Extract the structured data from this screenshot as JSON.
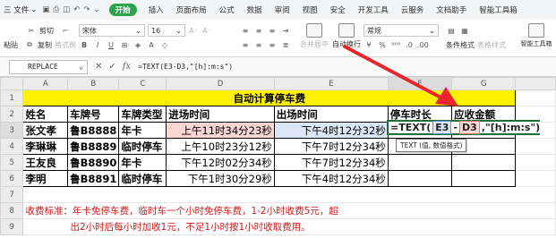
{
  "menubar": {
    "file_label": "三 文件",
    "start_label": "开始",
    "tabs": [
      "插入",
      "页面布局",
      "公式",
      "数据",
      "审阅",
      "视图",
      "安全",
      "开发工具",
      "云服务",
      "文档助手",
      "智能工具箱"
    ]
  },
  "toolbar": {
    "cut": "剪切",
    "paste": "粘贴",
    "copy": "复制",
    "format_painter": "格式刷",
    "font_name": "宋体",
    "font_size": "16",
    "merge_center": "合并居中",
    "wrap": "自动换行",
    "number_format": "常规",
    "cond_format": "条件格式",
    "table_style": "表格样式",
    "smart_toolbox": "智能工具箱"
  },
  "formula_bar": {
    "name_box": "REPLACE",
    "formula": "=TEXT(E3-D3,\"[h]:m:s\")"
  },
  "grid": {
    "columns": [
      "A",
      "B",
      "C",
      "D",
      "E",
      "F",
      "G"
    ],
    "rows": [
      "1",
      "2",
      "3",
      "4",
      "5",
      "6",
      "7",
      "8",
      "9"
    ],
    "title": "自动计算停车费",
    "headers": [
      "姓名",
      "车牌号",
      "车牌类型",
      "进场时间",
      "出场时间",
      "停车时长",
      "应收金额"
    ],
    "records": [
      [
        "张文孝",
        "鲁B8888",
        "年卡",
        "上午11时34分23秒",
        "下午4时12分32秒"
      ],
      [
        "李琳琳",
        "鲁B8889",
        "临时停车",
        "上午10时23分12秒",
        "下午7时12分34秒"
      ],
      [
        "王友良",
        "鲁B8890",
        "年卡",
        "下午12时02分34秒",
        "下午7时12分34秒"
      ],
      [
        "李明",
        "鲁B8891",
        "临时停车",
        "下午1时30分29秒",
        "下午4时12分34秒"
      ]
    ],
    "note_line1": "收费标准：年卡免停车费，临时车一个小时免停车费，1-2小时收费5元，超",
    "note_line2": "出2小时后每小时加收1元，不足1小时按1小时收取费用。"
  },
  "edit": {
    "prefix": "=TEXT(",
    "ref1": "E3",
    "minus": "-",
    "ref2": "D3",
    "suffix": ",\"[h]:m:s\")",
    "tooltip": "TEXT (值, 数值格式)"
  },
  "colors": {
    "title_fill": "#fff200",
    "start_button": "#2aa34a",
    "arrow": "#e8262c",
    "note_text": "#d11a1a"
  }
}
